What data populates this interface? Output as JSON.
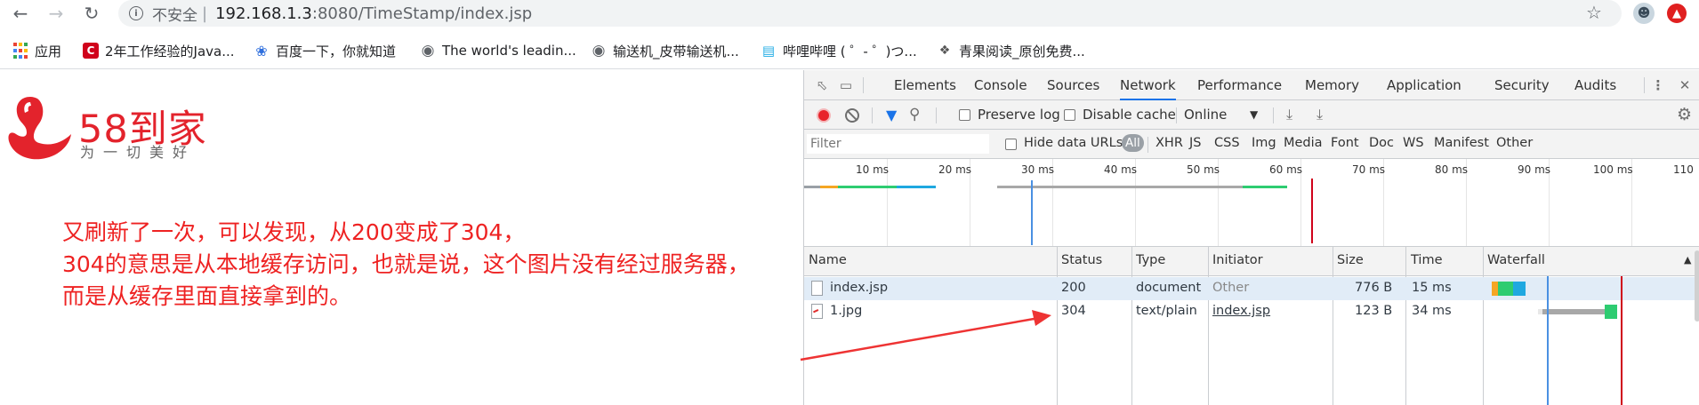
{
  "browser": {
    "security": "不安全",
    "url_host": "192.168.1.3",
    "url_path": ":8080/TimeStamp/index.jsp",
    "icons": [
      "back-icon",
      "forward-icon",
      "reload-icon",
      "info-icon",
      "star-icon"
    ]
  },
  "bookmarks": [
    {
      "label": "应用",
      "icon": "apps-icon"
    },
    {
      "label": "2年工作经验的Java...",
      "icon": "c-icon"
    },
    {
      "label": "百度一下，你就知道",
      "icon": "paw-icon"
    },
    {
      "label": "The world's leadin...",
      "icon": "globe-icon"
    },
    {
      "label": "输送机_皮带输送机...",
      "icon": "globe-icon"
    },
    {
      "label": "哔哩哔哩 ( ゜- ゜)つ...",
      "icon": "tv-icon"
    },
    {
      "label": "青果阅读_原创免费...",
      "icon": "fruit-icon"
    }
  ],
  "page": {
    "logo_name": "58到家",
    "logo_slogan": "为一切美好",
    "note_lines": [
      "又刷新了一次，可以发现，从200变成了304，",
      "304的意思是从本地缓存访问，也就是说，这个图片没有经过服务器，",
      "而是从缓存里面直接拿到的。"
    ],
    "colors": {
      "brand": "#e3232c",
      "note": "#ee2222"
    }
  },
  "devtools": {
    "tabs": [
      {
        "label": "Elements"
      },
      {
        "label": "Console"
      },
      {
        "label": "Sources"
      },
      {
        "label": "Network",
        "active": true
      },
      {
        "label": "Performance"
      },
      {
        "label": "Memory"
      },
      {
        "label": "Application"
      },
      {
        "label": "Security"
      },
      {
        "label": "Audits"
      }
    ],
    "toolbar": {
      "preserve_log": "Preserve log",
      "disable_cache": "Disable cache",
      "throttle": "Online"
    },
    "filterbar": {
      "placeholder": "Filter",
      "hide_data_urls": "Hide data URLs",
      "types": [
        "All",
        "XHR",
        "JS",
        "CSS",
        "Img",
        "Media",
        "Font",
        "Doc",
        "WS",
        "Manifest",
        "Other"
      ]
    },
    "overview_ticks": [
      "10 ms",
      "20 ms",
      "30 ms",
      "40 ms",
      "50 ms",
      "60 ms",
      "70 ms",
      "80 ms",
      "90 ms",
      "100 ms",
      "110"
    ],
    "columns": [
      "Name",
      "Status",
      "Type",
      "Initiator",
      "Size",
      "Time",
      "Waterfall"
    ],
    "rows": [
      {
        "name": "index.jsp",
        "status": "200",
        "type": "document",
        "initiator": "Other",
        "size": "776 B",
        "time": "15 ms"
      },
      {
        "name": "1.jpg",
        "status": "304",
        "type": "text/plain",
        "initiator": "index.jsp",
        "size": "123 B",
        "time": "34 ms"
      }
    ]
  }
}
